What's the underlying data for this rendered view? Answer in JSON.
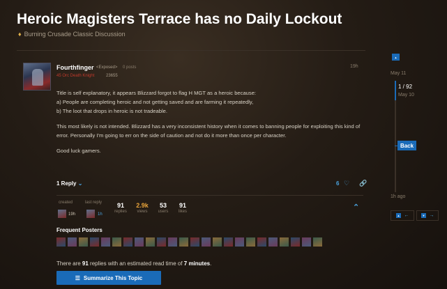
{
  "topic": {
    "title": "Heroic Magisters Terrace has no Daily Lockout",
    "category": "Burning Crusade Classic Discussion"
  },
  "post": {
    "username": "Fourthfinger",
    "flair": "<Exposed>",
    "posts": "0 posts",
    "character": "45 Orc Death Knight",
    "character_number": "23655",
    "time": "19h",
    "paragraphs": [
      "Title is self explanatory, it appears Blizzard forgot to flag H MGT as a heroic because:",
      "a) People are completing heroic and not getting saved and are farming it repeatedly,",
      "b) The loot that drops in heroic is not tradeable.",
      "This most likely is not intended. Blizzard has a very inconsistent history when it comes to banning people for exploiting this kind of error. Personally I'm going to err on the side of caution and not do it more than once per character.",
      "Good luck gamers."
    ],
    "reply_label": "1 Reply",
    "likes": "6"
  },
  "meta": {
    "created_label": "created",
    "created_time": "19h",
    "last_reply_label": "last reply",
    "last_reply_time": "1h",
    "replies": "91",
    "replies_label": "replies",
    "views": "2.9k",
    "views_label": "views",
    "users": "53",
    "users_label": "users",
    "likes": "91",
    "likes_label": "likes"
  },
  "frequent_posters": {
    "title": "Frequent Posters",
    "count": 24
  },
  "summary": {
    "prefix": "There are ",
    "replies": "91",
    "middle": " replies with an estimated read time of ",
    "read_time": "7 minutes",
    "suffix": ".",
    "button_label": "Summarize This Topic"
  },
  "timeline": {
    "top_date": "May 11",
    "position": "1 / 92",
    "position_date": "May 10",
    "back_label": "Back",
    "bottom_date": "1h ago"
  },
  "colors": {
    "accent": "#1a6bb8",
    "link": "#4aa3df",
    "hot": "#e8a33a",
    "class_color": "#c0392b"
  }
}
